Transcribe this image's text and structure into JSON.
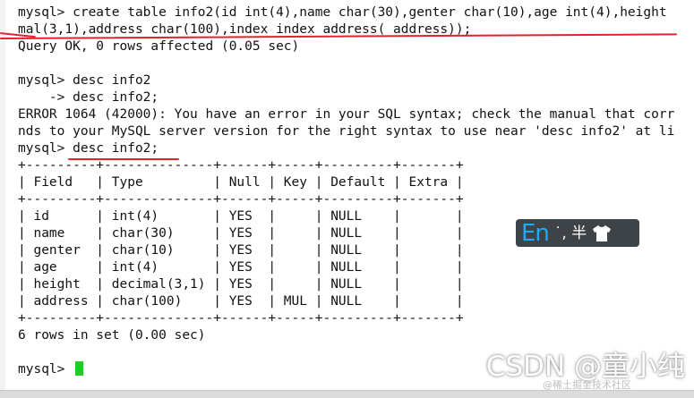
{
  "terminal": {
    "lines": [
      "mysql> create table info2(id int(4),name char(30),genter char(10),age int(4),height",
      "mal(3,1),address char(100),index index_address( address));",
      "Query OK, 0 rows affected (0.05 sec)",
      "",
      "mysql> desc info2",
      "    -> desc info2;",
      "ERROR 1064 (42000): You have an error in your SQL syntax; check the manual that corr",
      "nds to your MySQL server version for the right syntax to use near 'desc info2' at li",
      "mysql> desc info2;",
      "+---------+--------------+------+-----+---------+-------+",
      "| Field   | Type         | Null | Key | Default | Extra |",
      "+---------+--------------+------+-----+---------+-------+",
      "| id      | int(4)       | YES  |     | NULL    |       |",
      "| name    | char(30)     | YES  |     | NULL    |       |",
      "| genter  | char(10)     | YES  |     | NULL    |       |",
      "| age     | int(4)       | YES  |     | NULL    |       |",
      "| height  | decimal(3,1) | YES  |     | NULL    |       |",
      "| address | char(100)    | YES  | MUL | NULL    |       |",
      "+---------+--------------+------+-----+---------+-------+",
      "6 rows in set (0.00 sec)",
      "",
      "mysql> "
    ]
  },
  "ime": {
    "mode": "En",
    "status": "˙, 半"
  },
  "watermark": {
    "big": "CSDN @童小纯",
    "small": "@稀土掘金技术社区"
  },
  "colors": {
    "annotation": "#e0232e",
    "cursor": "#22cc22",
    "ime_accent": "#23a9f2"
  }
}
